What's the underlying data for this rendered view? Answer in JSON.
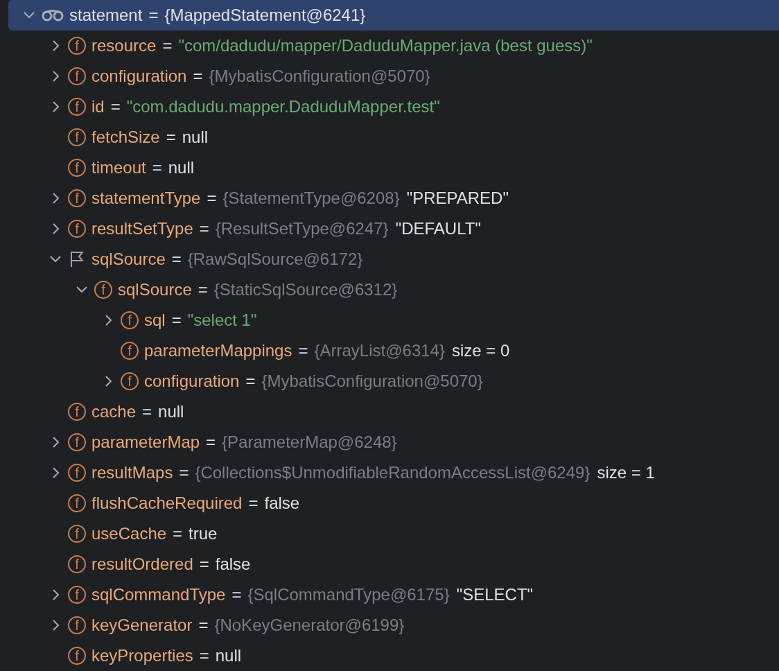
{
  "tree": [
    {
      "name": "statement",
      "expanded": true,
      "selected": true,
      "icon": {
        "kind": "watch"
      },
      "value": [
        {
          "kind": "ref",
          "text": "{MappedStatement@6241}"
        }
      ],
      "children": [
        {
          "name": "resource",
          "expanded": false,
          "selected": false,
          "icon": {
            "kind": "field",
            "text": "f"
          },
          "value": [
            {
              "kind": "string",
              "text": "\"com/dadudu/mapper/DaduduMapper.java (best guess)\""
            }
          ]
        },
        {
          "name": "configuration",
          "expanded": false,
          "selected": false,
          "icon": {
            "kind": "field",
            "text": "f"
          },
          "value": [
            {
              "kind": "ref",
              "text": "{MybatisConfiguration@5070}"
            }
          ]
        },
        {
          "name": "id",
          "expanded": false,
          "selected": false,
          "icon": {
            "kind": "field",
            "text": "f"
          },
          "value": [
            {
              "kind": "string",
              "text": "\"com.dadudu.mapper.DaduduMapper.test\""
            }
          ]
        },
        {
          "name": "fetchSize",
          "selected": false,
          "icon": {
            "kind": "field",
            "text": "f"
          },
          "value": [
            {
              "kind": "plain",
              "text": "null"
            }
          ]
        },
        {
          "name": "timeout",
          "selected": false,
          "icon": {
            "kind": "field",
            "text": "f"
          },
          "value": [
            {
              "kind": "plain",
              "text": "null"
            }
          ]
        },
        {
          "name": "statementType",
          "expanded": false,
          "selected": false,
          "icon": {
            "kind": "field",
            "text": "f"
          },
          "value": [
            {
              "kind": "ref",
              "text": "{StatementType@6208}"
            },
            {
              "kind": "plain",
              "text": "\"PREPARED\""
            }
          ]
        },
        {
          "name": "resultSetType",
          "expanded": false,
          "selected": false,
          "icon": {
            "kind": "field",
            "text": "f"
          },
          "value": [
            {
              "kind": "ref",
              "text": "{ResultSetType@6247}"
            },
            {
              "kind": "plain",
              "text": "\"DEFAULT\""
            }
          ]
        },
        {
          "name": "sqlSource",
          "expanded": true,
          "selected": false,
          "icon": {
            "kind": "flag"
          },
          "value": [
            {
              "kind": "ref",
              "text": "{RawSqlSource@6172}"
            }
          ],
          "children": [
            {
              "name": "sqlSource",
              "expanded": true,
              "selected": false,
              "icon": {
                "kind": "field",
                "text": "f"
              },
              "value": [
                {
                  "kind": "ref",
                  "text": "{StaticSqlSource@6312}"
                }
              ],
              "children": [
                {
                  "name": "sql",
                  "expanded": false,
                  "selected": false,
                  "icon": {
                    "kind": "field",
                    "text": "f"
                  },
                  "value": [
                    {
                      "kind": "string",
                      "text": "\"select 1\""
                    }
                  ]
                },
                {
                  "name": "parameterMappings",
                  "selected": false,
                  "icon": {
                    "kind": "field",
                    "text": "f"
                  },
                  "value": [
                    {
                      "kind": "ref",
                      "text": "{ArrayList@6314}"
                    },
                    {
                      "kind": "plain",
                      "text": "size = 0"
                    }
                  ]
                },
                {
                  "name": "configuration",
                  "expanded": false,
                  "selected": false,
                  "icon": {
                    "kind": "field",
                    "text": "f"
                  },
                  "value": [
                    {
                      "kind": "ref",
                      "text": "{MybatisConfiguration@5070}"
                    }
                  ]
                }
              ]
            }
          ]
        },
        {
          "name": "cache",
          "selected": false,
          "icon": {
            "kind": "field",
            "text": "f"
          },
          "value": [
            {
              "kind": "plain",
              "text": "null"
            }
          ]
        },
        {
          "name": "parameterMap",
          "expanded": false,
          "selected": false,
          "icon": {
            "kind": "field",
            "text": "f"
          },
          "value": [
            {
              "kind": "ref",
              "text": "{ParameterMap@6248}"
            }
          ]
        },
        {
          "name": "resultMaps",
          "expanded": false,
          "selected": false,
          "icon": {
            "kind": "field",
            "text": "f"
          },
          "value": [
            {
              "kind": "ref",
              "text": "{Collections$UnmodifiableRandomAccessList@6249}"
            },
            {
              "kind": "plain",
              "text": "size = 1"
            }
          ]
        },
        {
          "name": "flushCacheRequired",
          "selected": false,
          "icon": {
            "kind": "field",
            "text": "f"
          },
          "value": [
            {
              "kind": "plain",
              "text": "false"
            }
          ]
        },
        {
          "name": "useCache",
          "selected": false,
          "icon": {
            "kind": "field",
            "text": "f"
          },
          "value": [
            {
              "kind": "plain",
              "text": "true"
            }
          ]
        },
        {
          "name": "resultOrdered",
          "selected": false,
          "icon": {
            "kind": "field",
            "text": "f"
          },
          "value": [
            {
              "kind": "plain",
              "text": "false"
            }
          ]
        },
        {
          "name": "sqlCommandType",
          "expanded": false,
          "selected": false,
          "icon": {
            "kind": "field",
            "text": "f"
          },
          "value": [
            {
              "kind": "ref",
              "text": "{SqlCommandType@6175}"
            },
            {
              "kind": "plain",
              "text": "\"SELECT\""
            }
          ]
        },
        {
          "name": "keyGenerator",
          "expanded": false,
          "selected": false,
          "icon": {
            "kind": "field",
            "text": "f"
          },
          "value": [
            {
              "kind": "ref",
              "text": "{NoKeyGenerator@6199}"
            }
          ]
        },
        {
          "name": "keyProperties",
          "selected": false,
          "icon": {
            "kind": "field",
            "text": "f"
          },
          "value": [
            {
              "kind": "plain",
              "text": "null"
            }
          ]
        }
      ]
    }
  ],
  "equals": "="
}
